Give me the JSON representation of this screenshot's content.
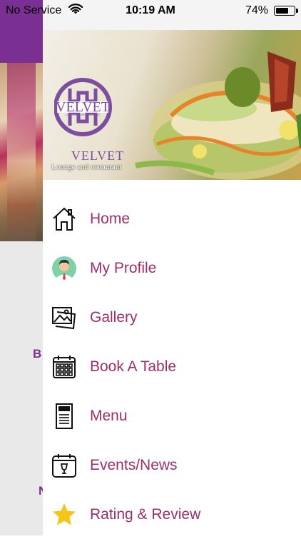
{
  "status_bar": {
    "carrier": "No Service",
    "time": "10:19 AM",
    "battery_percent": "74%",
    "battery_level": 0.74
  },
  "background_app": {
    "letters": [
      "B",
      "N"
    ]
  },
  "drawer": {
    "header": {
      "logo_name": "VELVET",
      "logo_caption": "LOUNGE & RESTAURANT",
      "brand": "VELVET",
      "tagline": "Lounge and restaurant"
    },
    "menu": [
      {
        "label": "Home",
        "icon": "home-icon"
      },
      {
        "label": "My Profile",
        "icon": "profile-avatar-icon"
      },
      {
        "label": "Gallery",
        "icon": "gallery-icon"
      },
      {
        "label": "Book A Table",
        "icon": "calendar-icon"
      },
      {
        "label": "Menu",
        "icon": "menu-card-icon"
      },
      {
        "label": "Events/News",
        "icon": "event-icon"
      },
      {
        "label": "Rating & Review",
        "icon": "star-icon"
      }
    ]
  },
  "colors": {
    "accent": "#9b2f6e",
    "brand_purple": "#7a2f93",
    "star": "#f5c518"
  }
}
